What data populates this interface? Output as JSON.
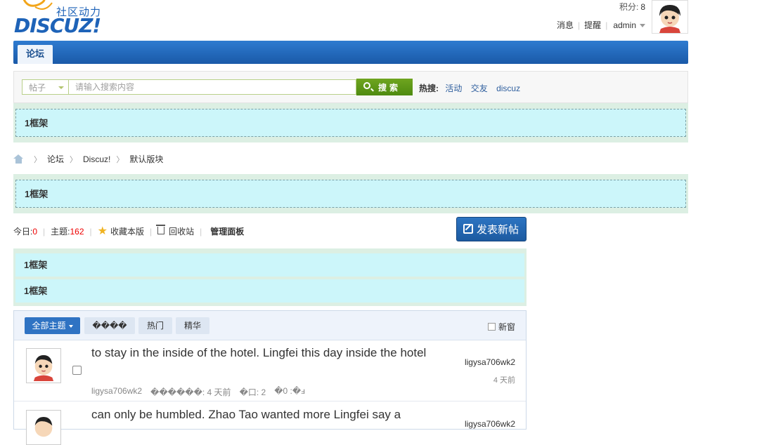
{
  "header": {
    "logo_tagline": "社区动力",
    "logo_text": "DISCUZ!",
    "points_label": "积分:",
    "points_value": "8",
    "nav_links": [
      "消息",
      "提醒"
    ],
    "username": "admin"
  },
  "nav": {
    "tabs": [
      {
        "label": "论坛",
        "active": true
      }
    ]
  },
  "search": {
    "type_selected": "帖子",
    "placeholder": "请输入搜索内容",
    "button_label": "搜索",
    "hot_label": "热搜:",
    "hot_terms": [
      "活动",
      "交友",
      "discuz"
    ]
  },
  "frames": {
    "top_frame_label": "1框架",
    "mid_frame_label": "1框架",
    "list_frame_1_label": "1框架",
    "list_frame_2_label": "1框架"
  },
  "breadcrumb": [
    "论坛",
    "Discuz!",
    "默认版块"
  ],
  "forum_stats": {
    "today_label": "今日:",
    "today_value": "0",
    "topics_label": "主题:",
    "topics_value": "162",
    "favorite_label": "收藏本版",
    "recycle_label": "回收站",
    "admin_label": "管理面板"
  },
  "post_button_label": "发表新帖",
  "thread_filters": [
    {
      "label": "全部主题",
      "active": true
    },
    {
      "label": "����",
      "active": false
    },
    {
      "label": "热门",
      "active": false
    },
    {
      "label": "精华",
      "active": false
    }
  ],
  "new_window_label": "新窗",
  "threads": [
    {
      "title": "to stay in the inside of the hotel. Lingfei this day inside the hotel",
      "author": "ligysa706wk2",
      "meta_time": "������: 4 天前",
      "meta_replies": "�口: 2",
      "meta_views": "�0 :�ⅎ",
      "last_poster": "ligysa706wk2",
      "last_time": "4 天前"
    },
    {
      "title": "can only be humbled. Zhao Tao wanted more Lingfei say a",
      "last_poster": "ligysa706wk2"
    }
  ],
  "colors": {
    "brand_blue": "#1e63b8",
    "nav_blue": "#2e7bd0",
    "search_green": "#5e9a18",
    "frame_cyan": "#ccf6fa",
    "stat_red": "#ee0000"
  }
}
